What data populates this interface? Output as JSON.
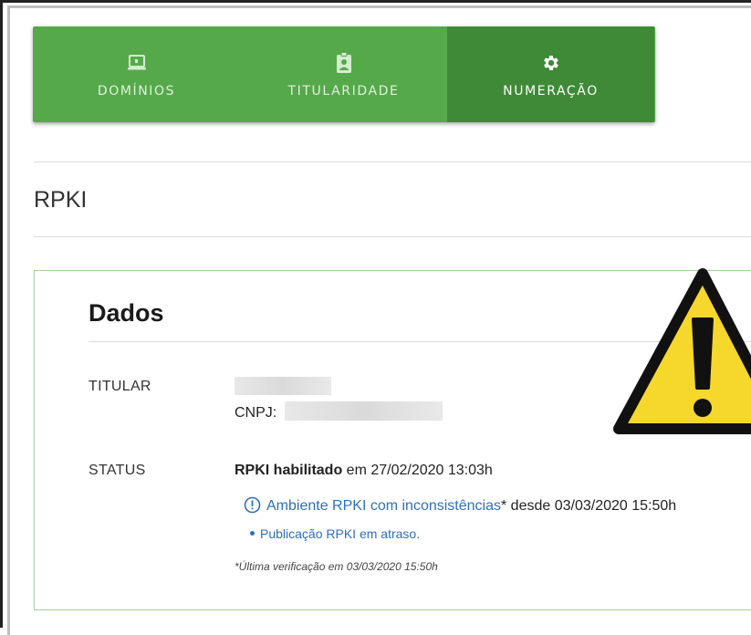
{
  "tabs": [
    {
      "label": "DOMÍNIOS",
      "icon": "laptop-icon",
      "active": false
    },
    {
      "label": "TITULARIDADE",
      "icon": "id-badge-icon",
      "active": false
    },
    {
      "label": "NUMERAÇÃO",
      "icon": "gear-icon",
      "active": true
    }
  ],
  "page": {
    "title": "RPKI"
  },
  "dados": {
    "title": "Dados",
    "titular_label": "TITULAR",
    "cnpj_label": "CNPJ:",
    "status_label": "STATUS",
    "status_bold": "RPKI habilitado",
    "status_rest": " em 27/02/2020 13:03h",
    "alert_link": "Ambiente RPKI com inconsistências",
    "alert_rest": "* desde 03/03/2020 15:50h",
    "bullet_item": "Publicação RPKI em atraso.",
    "note": "*Última verificação em 03/03/2020 15:50h"
  },
  "colors": {
    "tab_bar": "#55a94a",
    "tab_active": "#3f8a37",
    "panel_border": "#a7cf9f",
    "link": "#2f6ec2",
    "warning_fill": "#f6d72c"
  }
}
